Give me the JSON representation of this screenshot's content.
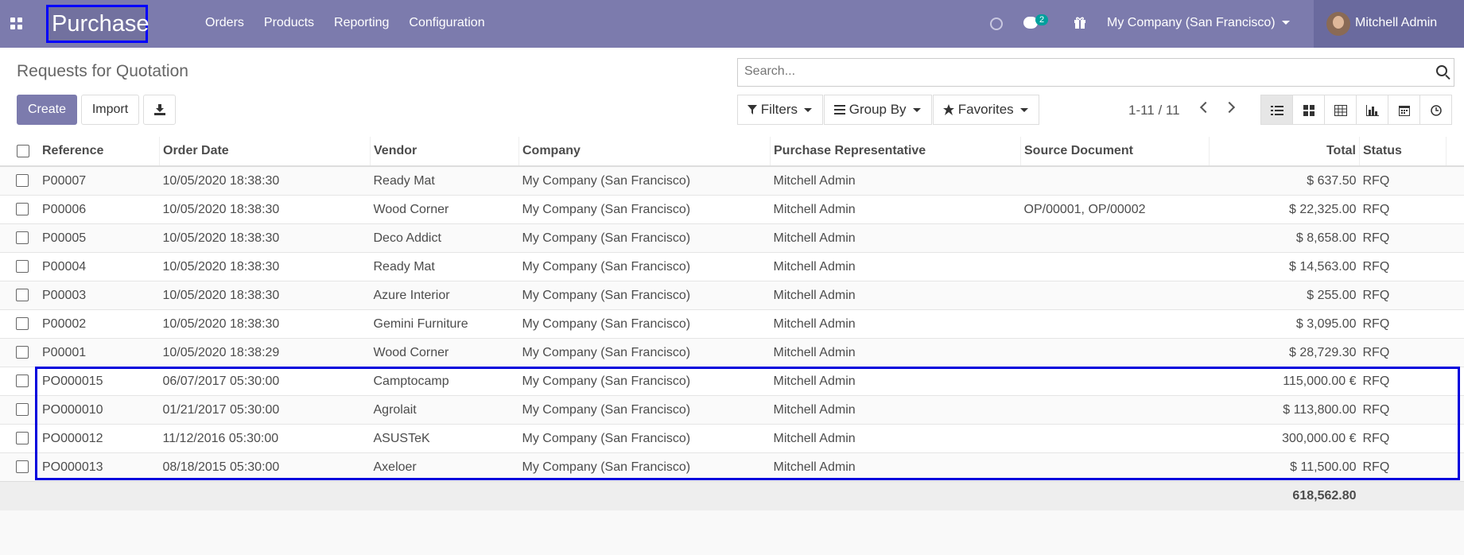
{
  "app": {
    "brand": "Purchase",
    "nav": [
      "Orders",
      "Products",
      "Reporting",
      "Configuration"
    ],
    "chat_count": "2",
    "company": "My Company (San Francisco)",
    "user": "Mitchell Admin"
  },
  "control": {
    "title": "Requests for Quotation",
    "create_label": "Create",
    "import_label": "Import",
    "search_placeholder": "Search...",
    "filters_label": "Filters",
    "groupby_label": "Group By",
    "favorites_label": "Favorites",
    "pager": "1-11 / 11"
  },
  "views": [
    "list",
    "kanban",
    "pivot",
    "graph",
    "calendar",
    "activity"
  ],
  "columns": [
    "Reference",
    "Order Date",
    "Vendor",
    "Company",
    "Purchase Representative",
    "Source Document",
    "Total",
    "Status"
  ],
  "rows": [
    {
      "ref": "P00007",
      "date": "10/05/2020 18:38:30",
      "vendor": "Ready Mat",
      "company": "My Company (San Francisco)",
      "rep": "Mitchell Admin",
      "source": "",
      "total": "$ 637.50",
      "status": "RFQ"
    },
    {
      "ref": "P00006",
      "date": "10/05/2020 18:38:30",
      "vendor": "Wood Corner",
      "company": "My Company (San Francisco)",
      "rep": "Mitchell Admin",
      "source": "OP/00001, OP/00002",
      "total": "$ 22,325.00",
      "status": "RFQ"
    },
    {
      "ref": "P00005",
      "date": "10/05/2020 18:38:30",
      "vendor": "Deco Addict",
      "company": "My Company (San Francisco)",
      "rep": "Mitchell Admin",
      "source": "",
      "total": "$ 8,658.00",
      "status": "RFQ"
    },
    {
      "ref": "P00004",
      "date": "10/05/2020 18:38:30",
      "vendor": "Ready Mat",
      "company": "My Company (San Francisco)",
      "rep": "Mitchell Admin",
      "source": "",
      "total": "$ 14,563.00",
      "status": "RFQ"
    },
    {
      "ref": "P00003",
      "date": "10/05/2020 18:38:30",
      "vendor": "Azure Interior",
      "company": "My Company (San Francisco)",
      "rep": "Mitchell Admin",
      "source": "",
      "total": "$ 255.00",
      "status": "RFQ"
    },
    {
      "ref": "P00002",
      "date": "10/05/2020 18:38:30",
      "vendor": "Gemini Furniture",
      "company": "My Company (San Francisco)",
      "rep": "Mitchell Admin",
      "source": "",
      "total": "$ 3,095.00",
      "status": "RFQ"
    },
    {
      "ref": "P00001",
      "date": "10/05/2020 18:38:29",
      "vendor": "Wood Corner",
      "company": "My Company (San Francisco)",
      "rep": "Mitchell Admin",
      "source": "",
      "total": "$ 28,729.30",
      "status": "RFQ"
    },
    {
      "ref": "PO000015",
      "date": "06/07/2017 05:30:00",
      "vendor": "Camptocamp",
      "company": "My Company (San Francisco)",
      "rep": "Mitchell Admin",
      "source": "",
      "total": "115,000.00 €",
      "status": "RFQ"
    },
    {
      "ref": "PO000010",
      "date": "01/21/2017 05:30:00",
      "vendor": "Agrolait",
      "company": "My Company (San Francisco)",
      "rep": "Mitchell Admin",
      "source": "",
      "total": "$ 113,800.00",
      "status": "RFQ"
    },
    {
      "ref": "PO000012",
      "date": "11/12/2016 05:30:00",
      "vendor": "ASUSTeK",
      "company": "My Company (San Francisco)",
      "rep": "Mitchell Admin",
      "source": "",
      "total": "300,000.00 €",
      "status": "RFQ"
    },
    {
      "ref": "PO000013",
      "date": "08/18/2015 05:30:00",
      "vendor": "Axeloer",
      "company": "My Company (San Francisco)",
      "rep": "Mitchell Admin",
      "source": "",
      "total": "$ 11,500.00",
      "status": "RFQ"
    }
  ],
  "footer_total": "618,562.80",
  "colors": {
    "brand": "#7c7bad",
    "highlight": "#0000dd"
  }
}
